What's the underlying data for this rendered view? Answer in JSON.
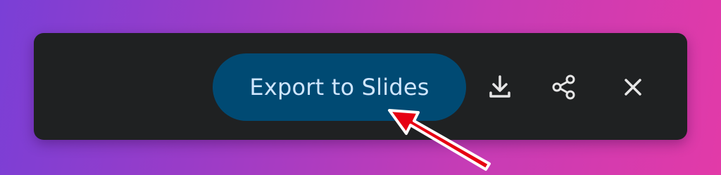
{
  "toolbar": {
    "export_button_label": "Export to Slides",
    "icons": {
      "download": "download-icon",
      "share": "share-icon",
      "close": "close-icon"
    }
  },
  "colors": {
    "toolbar_bg": "#1f2122",
    "export_button_bg": "#004a73",
    "export_button_text": "#cfe6ff",
    "icon_color": "#e6e6e6",
    "annotation_arrow": "#e60012"
  }
}
